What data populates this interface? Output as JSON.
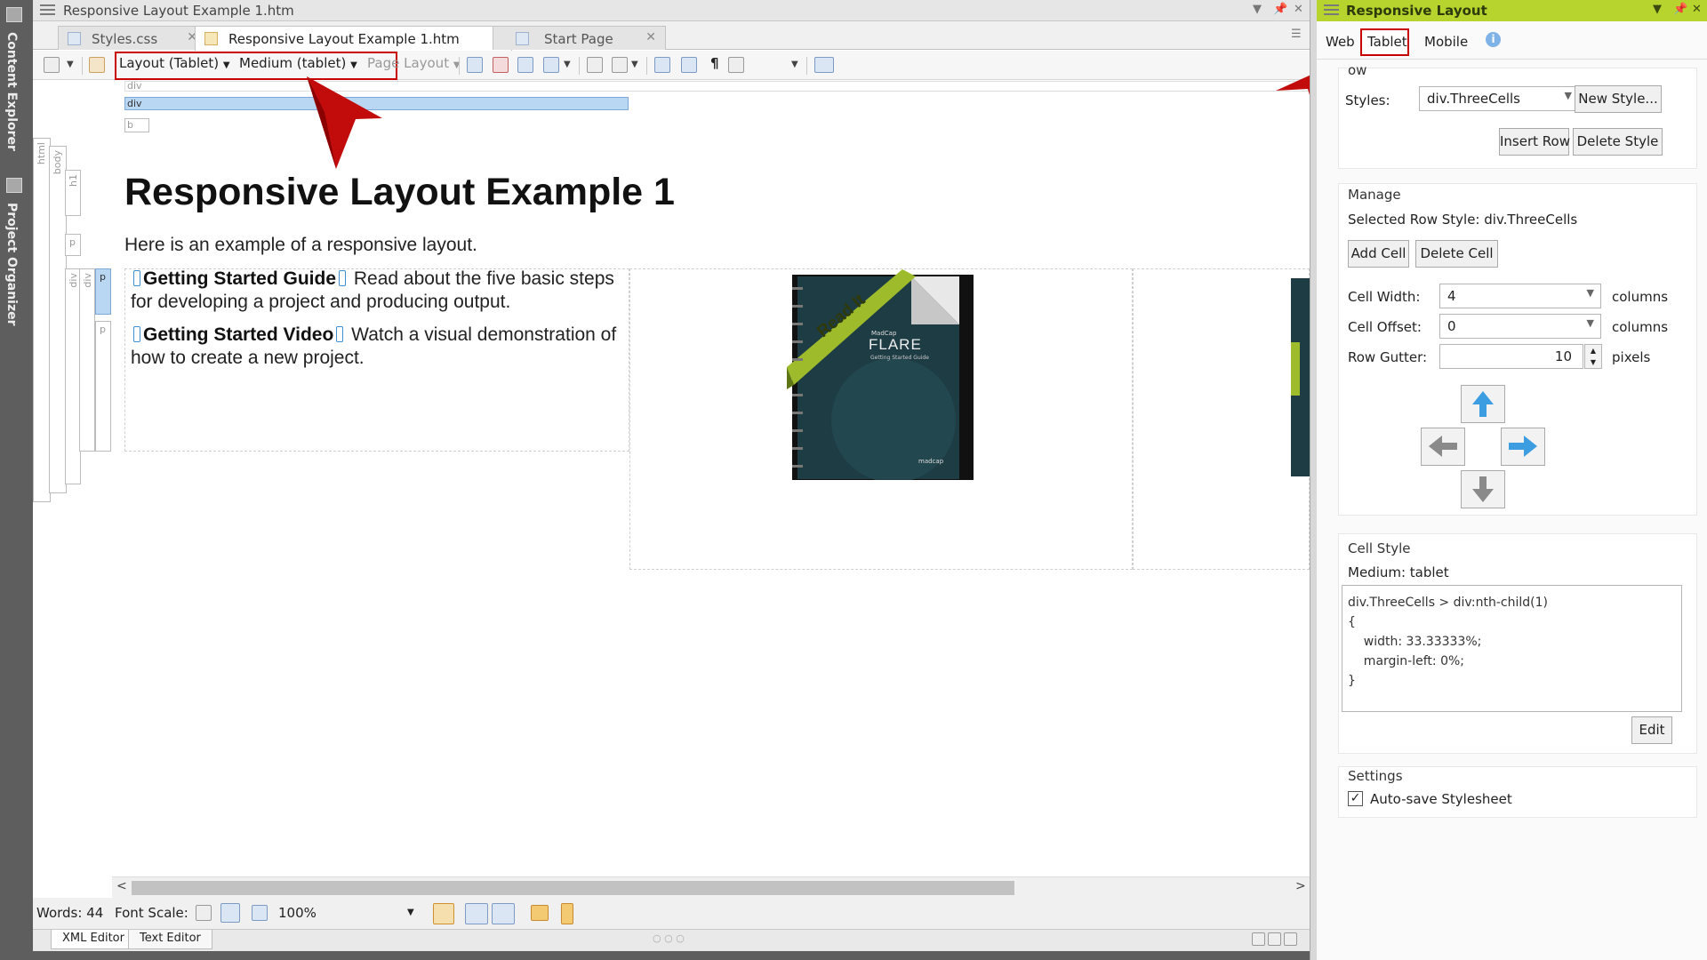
{
  "rail": {
    "items": [
      "Content Explorer",
      "Project Organizer"
    ]
  },
  "editor": {
    "title": "Responsive Layout Example 1.htm",
    "tabs": [
      {
        "label": "Styles.css",
        "close": "✕"
      },
      {
        "label": "Responsive Layout Example 1.htm",
        "close": "✕"
      },
      {
        "label": "Start Page",
        "close": "✕"
      }
    ],
    "toolbar": {
      "layout": "Layout (Tablet)",
      "medium": "Medium (tablet)",
      "page_layout": "Page Layout"
    },
    "structure_bars": {
      "div_top": "div",
      "div_selected": "div",
      "b": "b",
      "html": "html",
      "body": "body",
      "h1": "h1",
      "p1": "p",
      "div_a": "div",
      "div_b": "div",
      "p2": "p",
      "p3": "p"
    },
    "content": {
      "heading": "Responsive Layout Example 1",
      "intro": "Here is an example of a responsive layout.",
      "items": [
        {
          "bold": "Getting Started Guide",
          "text": "Read about the five basic steps for developing a project and producing output."
        },
        {
          "bold": "Getting Started Video",
          "text": "Watch a visual demonstration of how to create a new project."
        }
      ],
      "book": {
        "ribbon": "Read It",
        "brand": "MadCap",
        "title": "FLARE",
        "subtitle": "Getting Started Guide",
        "publisher": "madcap"
      }
    },
    "status": {
      "words": "Words: 44",
      "font_scale": "Font Scale:",
      "zoom": "100%"
    },
    "bottom_tabs": [
      "XML Editor",
      "Text Editor"
    ]
  },
  "panel": {
    "title": "Responsive Layout",
    "tabs": [
      "Web",
      "Tablet",
      "Mobile"
    ],
    "selected_tab": "Tablet",
    "row_group": {
      "title": "ow",
      "styles_label": "Styles:",
      "styles_value": "div.ThreeCells",
      "new_style": "New Style...",
      "insert_row": "Insert Row",
      "delete_style": "Delete Style"
    },
    "manage": {
      "title": "Manage",
      "selected_row": "Selected Row Style: div.ThreeCells",
      "add_cell": "Add Cell",
      "delete_cell": "Delete Cell",
      "cell_width_label": "Cell Width:",
      "cell_width": "4",
      "cell_offset_label": "Cell Offset:",
      "cell_offset": "0",
      "row_gutter_label": "Row Gutter:",
      "row_gutter": "10",
      "unit_columns": "columns",
      "unit_pixels": "pixels"
    },
    "cell_style": {
      "title": "Cell Style",
      "medium": "Medium: tablet",
      "css": "div.ThreeCells > div:nth-child(1)\n{\n    width: 33.33333%;\n    margin-left: 0%;\n}",
      "edit": "Edit"
    },
    "settings": {
      "title": "Settings",
      "autosave": "Auto-save Stylesheet",
      "autosave_checked": true
    }
  },
  "colors": {
    "accent_green": "#b7d32d",
    "callout_red": "#c80000",
    "cell_marker": "#3b8fd4"
  }
}
